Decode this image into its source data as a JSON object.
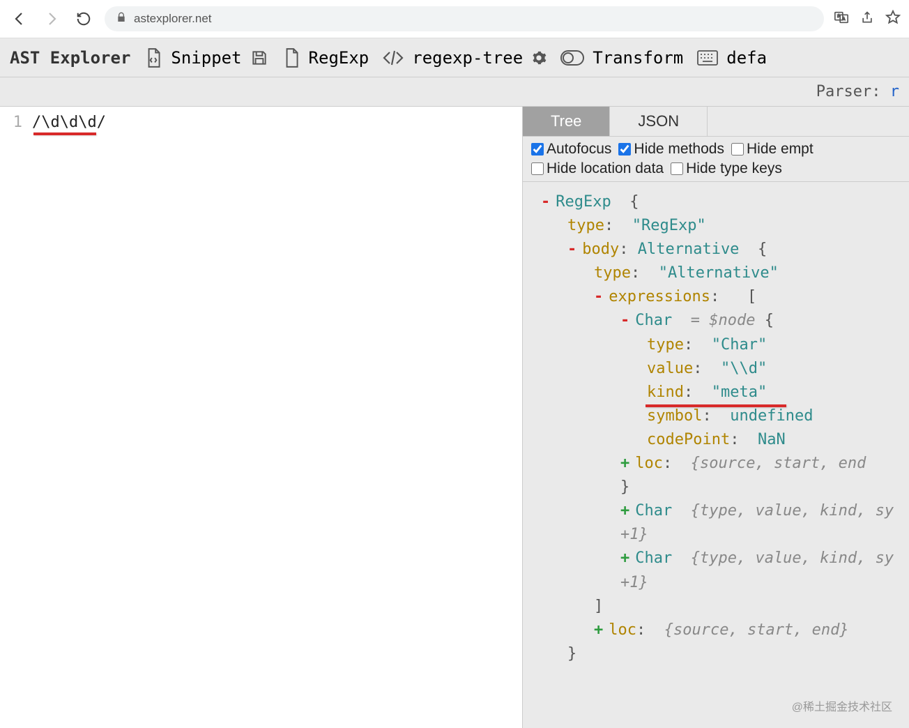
{
  "browser": {
    "url": "astexplorer.net"
  },
  "toolbar": {
    "logo": "AST Explorer",
    "snippet_label": "Snippet",
    "lang_label": "RegExp",
    "parser_label": "regexp-tree",
    "transform_label": "Transform",
    "keymap_label": "defa"
  },
  "subbar": {
    "parser_prefix": "Parser: ",
    "parser_link": "r"
  },
  "editor": {
    "line_number": "1",
    "code": "/\\d\\d\\d/"
  },
  "tabs": {
    "tree": "Tree",
    "json": "JSON"
  },
  "options": {
    "autofocus": "Autofocus",
    "hide_methods": "Hide methods",
    "hide_empty": "Hide empt",
    "hide_location": "Hide location data",
    "hide_type": "Hide type keys"
  },
  "ast": {
    "root": "RegExp",
    "type_key": "type",
    "type_val": "\"RegExp\"",
    "body_key": "body",
    "body_type": "Alternative",
    "alt_type_val": "\"Alternative\"",
    "expr_key": "expressions",
    "char_name": "Char",
    "node_comment": "= $node",
    "char_type_val": "\"Char\"",
    "value_key": "value",
    "value_val": "\"\\\\d\"",
    "kind_key": "kind",
    "kind_val": "\"meta\"",
    "symbol_key": "symbol",
    "symbol_val": "undefined",
    "codepoint_key": "codePoint",
    "codepoint_val": "NaN",
    "loc_key": "loc",
    "loc_summary": "{source, start, end",
    "collapsed_char_summary": "{type, value, kind, sy",
    "collapsed_char_plus1": "+1}",
    "body_loc_summary": "{source, start, end}"
  },
  "watermark": "@稀土掘金技术社区"
}
